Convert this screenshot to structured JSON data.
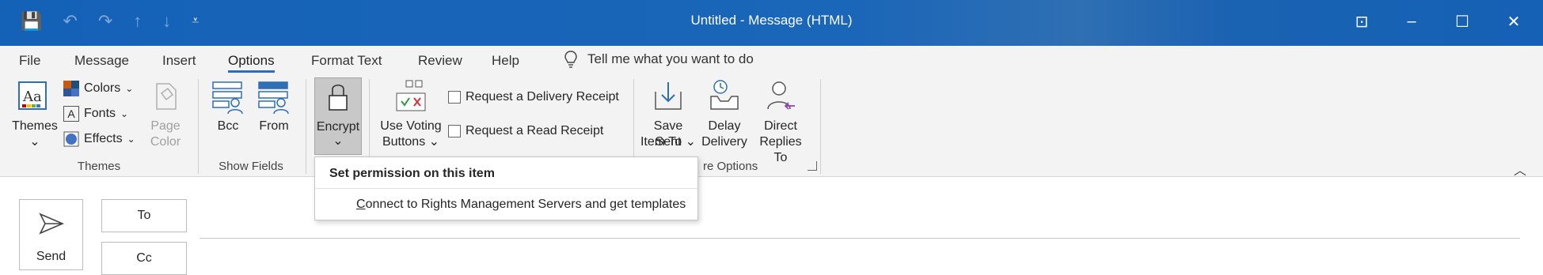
{
  "window": {
    "title": "Untitled  -  Message (HTML)",
    "qat": {
      "save_icon": "💾",
      "undo_icon": "↶",
      "redo_icon": "↷",
      "up_icon": "↑",
      "down_icon": "↓",
      "customize_icon": "⩡"
    },
    "controls": {
      "ribbon_display": "⊡",
      "minimize": "–",
      "maximize": "☐",
      "close": "✕"
    }
  },
  "tabs": [
    "File",
    "Message",
    "Insert",
    "Options",
    "Format Text",
    "Review",
    "Help"
  ],
  "active_tab": "Options",
  "tell_me": "Tell me what you want to do",
  "ribbon": {
    "themes_group": {
      "label": "Themes",
      "themes_button": "Themes",
      "colors": "Colors",
      "fonts": "Fonts",
      "effects": "Effects",
      "page_color_line1": "Page",
      "page_color_line2": "Color"
    },
    "show_fields_group": {
      "label": "Show Fields",
      "bcc": "Bcc",
      "from": "From"
    },
    "encrypt": {
      "label": "Encrypt"
    },
    "tracking_group": {
      "voting_line1": "Use Voting",
      "voting_line2": "Buttons",
      "delivery_receipt": "Request a Delivery Receipt",
      "read_receipt": "Request a Read Receipt"
    },
    "more_options_group": {
      "label": "re Options",
      "save_sent_line1": "Save Sent",
      "save_sent_line2": "Item To",
      "delay_line1": "Delay",
      "delay_line2": "Delivery",
      "direct_line1": "Direct",
      "direct_line2": "Replies To"
    }
  },
  "encrypt_dropdown": {
    "heading": "Set permission on this item",
    "item": "Connect to Rights Management Servers and get templates"
  },
  "compose": {
    "send": "Send",
    "to": "To",
    "cc": "Cc"
  },
  "colors": {
    "titlebar": "#1462b8",
    "ribbon_bg": "#f3f3f3",
    "active_tab_underline": "#2b6cc4"
  }
}
